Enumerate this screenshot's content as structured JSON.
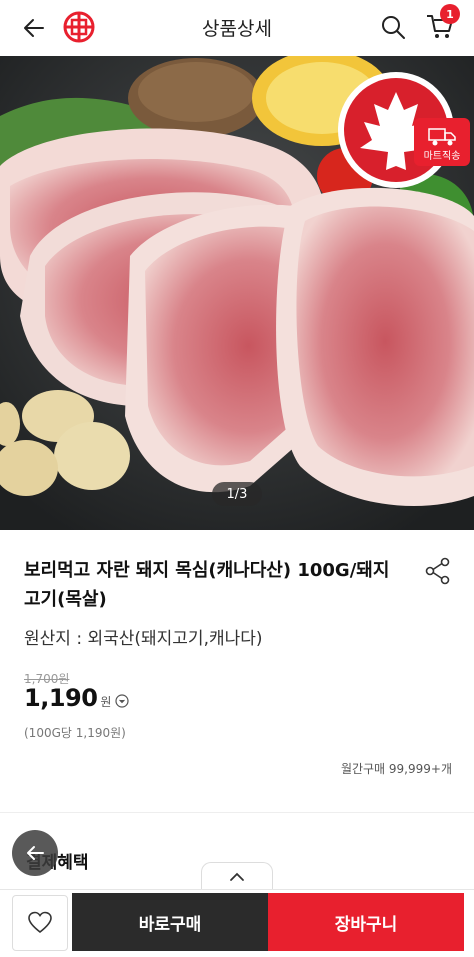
{
  "header": {
    "title": "상품상세",
    "cart_count": "1"
  },
  "hero": {
    "pager": "1/3",
    "delivery_badge": "마트직송"
  },
  "product": {
    "name": "보리먹고 자란 돼지 목심(캐나다산) 100G/돼지고기(목살)",
    "origin": "원산지 : 외국산(돼지고기,캐나다)",
    "original_price": "1,700원",
    "price": "1,190",
    "currency": "원",
    "unit_price": "(100G당 1,190원)",
    "monthly_sales": "월간구매 99,999+개"
  },
  "benefits": {
    "title": "결제혜택"
  },
  "bottom": {
    "buy_label": "바로구매",
    "cart_label": "장바구니"
  },
  "colors": {
    "accent": "#e8202e",
    "dark": "#2b2b2b"
  }
}
